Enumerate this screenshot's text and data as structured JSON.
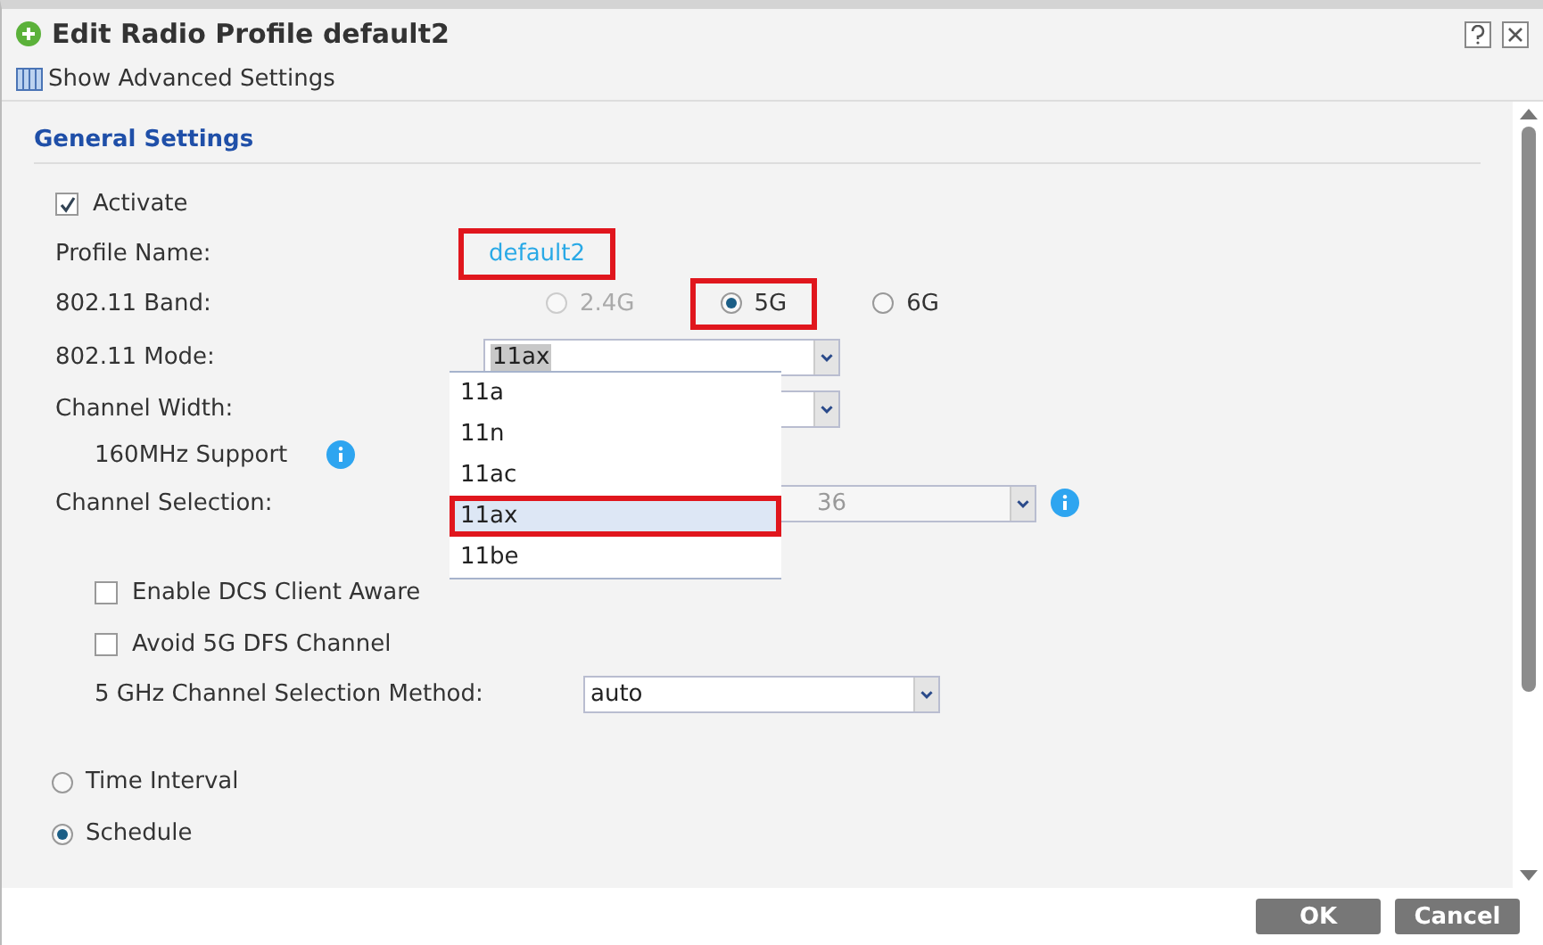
{
  "window": {
    "title": "Edit Radio Profile default2"
  },
  "toolbar": {
    "link": "Show Advanced Settings"
  },
  "section": {
    "title": "General Settings"
  },
  "activate": {
    "label": "Activate",
    "checked": true
  },
  "profile_name": {
    "label": "Profile Name:",
    "value": "default2",
    "highlighted": true
  },
  "band": {
    "label": "802.11 Band:",
    "options": [
      {
        "label": "2.4G",
        "selected": false,
        "disabled": true,
        "highlighted": false
      },
      {
        "label": "5G",
        "selected": true,
        "disabled": false,
        "highlighted": true
      },
      {
        "label": "6G",
        "selected": false,
        "disabled": false,
        "highlighted": false
      }
    ]
  },
  "mode": {
    "label": "802.11 Mode:",
    "value": "11ax",
    "options": [
      {
        "label": "11a",
        "selected": false,
        "highlighted": false
      },
      {
        "label": "11n",
        "selected": false,
        "highlighted": false
      },
      {
        "label": "11ac",
        "selected": false,
        "highlighted": false
      },
      {
        "label": "11ax",
        "selected": true,
        "highlighted": true
      },
      {
        "label": "11be",
        "selected": false,
        "highlighted": false
      }
    ]
  },
  "channel_width": {
    "label": "Channel Width:"
  },
  "support_160": {
    "label": "160MHz Support"
  },
  "channel_selection": {
    "label": "Channel Selection:",
    "value": "36",
    "disabled": true
  },
  "dcs": {
    "label": "Enable DCS Client Aware",
    "checked": false
  },
  "avoid_dfs": {
    "label": "Avoid 5G DFS Channel",
    "checked": false
  },
  "method": {
    "label": "5 GHz Channel Selection Method:",
    "value": "auto"
  },
  "schedule_type": [
    {
      "label": "Time Interval",
      "selected": false
    },
    {
      "label": "Schedule",
      "selected": true
    }
  ],
  "buttons": [
    "OK",
    "Cancel"
  ]
}
